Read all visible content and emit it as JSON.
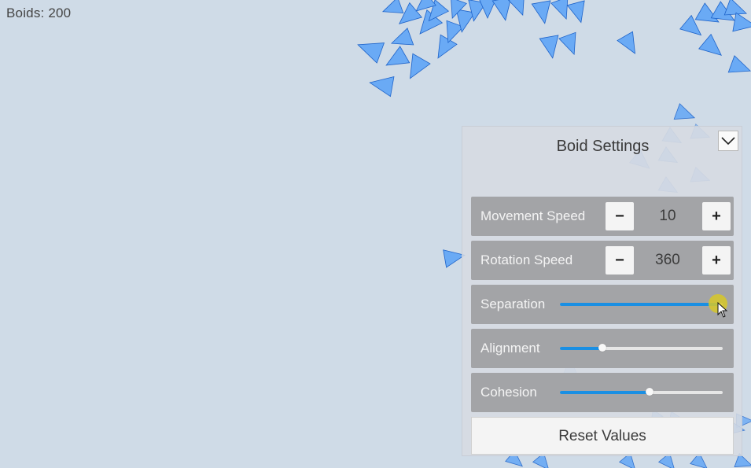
{
  "hud": {
    "boid_count": "Boids: 200"
  },
  "panel": {
    "title": "Boid Settings",
    "collapse_icon": "chevron-down-icon",
    "movement_speed": {
      "label": "Movement Speed",
      "value": "10",
      "decrement": "−",
      "increment": "+"
    },
    "rotation_speed": {
      "label": "Rotation Speed",
      "value": "360",
      "decrement": "−",
      "increment": "+"
    },
    "separation": {
      "label": "Separation",
      "level": 0.97
    },
    "alignment": {
      "label": "Alignment",
      "level": 0.26
    },
    "cohesion": {
      "label": "Cohesion",
      "level": 0.55
    },
    "reset_label": "Reset Values"
  },
  "colors": {
    "background": "#cfdbe7",
    "boid_fill": "#6aaaf5",
    "boid_stroke": "#1e63c9",
    "slider_fill": "#1a8fe3",
    "row_background": "#a3a4a7"
  }
}
